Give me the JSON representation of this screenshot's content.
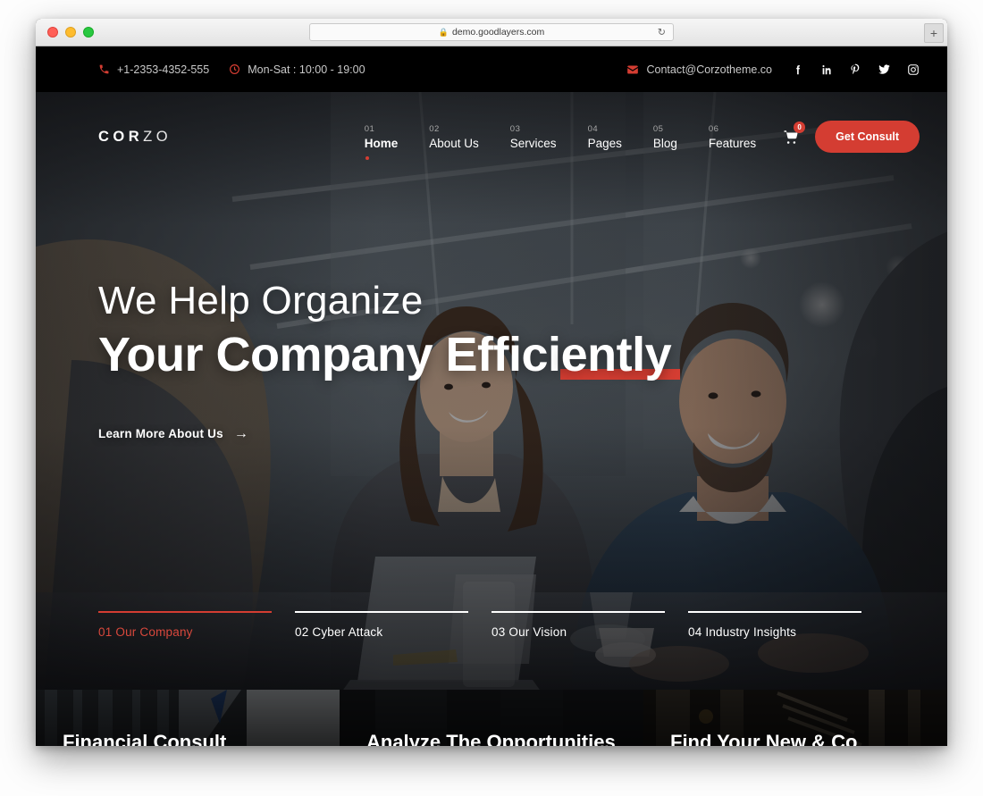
{
  "browser": {
    "url": "demo.goodlayers.com",
    "lock_icon": "lock-icon",
    "reload_icon": "reload-icon",
    "new_tab_label": "+",
    "traffic_lights": [
      "close",
      "minimize",
      "zoom"
    ]
  },
  "colors": {
    "accent": "#d43d32",
    "topbar_bg": "#000000",
    "text_light": "#ffffff",
    "muted": "#c9c9c9"
  },
  "topbar": {
    "phone": "+1-2353-4352-555",
    "phone_icon": "phone-icon",
    "hours": "Mon-Sat : 10:00 - 19:00",
    "hours_icon": "clock-icon",
    "email": "Contact@Corzotheme.co",
    "email_icon": "envelope-icon",
    "socials": [
      {
        "name": "facebook-icon",
        "label": "f"
      },
      {
        "name": "linkedin-icon",
        "label": "in"
      },
      {
        "name": "pinterest-icon",
        "label": "P"
      },
      {
        "name": "twitter-icon",
        "label": "t"
      },
      {
        "name": "instagram-icon",
        "label": "ig"
      }
    ]
  },
  "header": {
    "logo_bold": "COR",
    "logo_light": "ZO",
    "nav": [
      {
        "num": "01",
        "label": "Home",
        "active": true
      },
      {
        "num": "02",
        "label": "About Us",
        "active": false
      },
      {
        "num": "03",
        "label": "Services",
        "active": false
      },
      {
        "num": "04",
        "label": "Pages",
        "active": false
      },
      {
        "num": "05",
        "label": "Blog",
        "active": false
      },
      {
        "num": "06",
        "label": "Features",
        "active": false
      }
    ],
    "cart_icon": "cart-icon",
    "cart_count": "0",
    "consult_button": "Get Consult"
  },
  "hero": {
    "line1": "We Help Organize",
    "line2_a": "Your Company Effici",
    "line2_b": "ently",
    "cta": "Learn More About Us",
    "cta_arrow": "→"
  },
  "slider_nav": [
    {
      "label": "01 Our Company",
      "active": true
    },
    {
      "label": "02 Cyber Attack",
      "active": false
    },
    {
      "label": "03 Our Vision",
      "active": false
    },
    {
      "label": "04 Industry Insights",
      "active": false
    }
  ],
  "cards": [
    {
      "title": "Financial Consult"
    },
    {
      "title": "Analyze The Opportunities"
    },
    {
      "title": "Find Your New & Co"
    }
  ]
}
